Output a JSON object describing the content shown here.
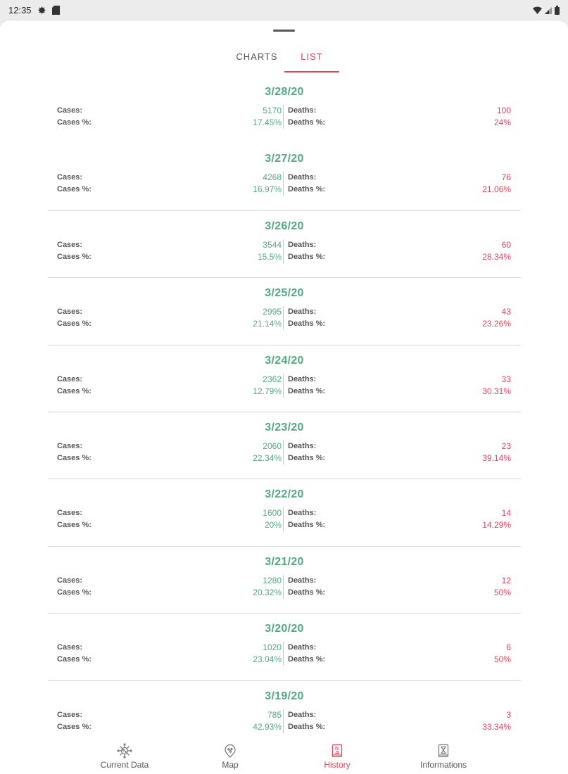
{
  "status_bar": {
    "time": "12:35",
    "icons": [
      "gear-icon",
      "sd-card-icon",
      "wifi-icon",
      "signal-icon",
      "battery-icon"
    ]
  },
  "tabs": [
    {
      "label": "CHARTS",
      "selected": false
    },
    {
      "label": "LIST",
      "selected": true
    }
  ],
  "labels": {
    "cases": "Cases:",
    "cases_pct": "Cases %:",
    "deaths": "Deaths:",
    "deaths_pct": "Deaths %:"
  },
  "entries": [
    {
      "date": "3/28/20",
      "cases": "5170",
      "cases_pct": "17.45%",
      "deaths": "100",
      "deaths_pct": "24%"
    },
    {
      "date": "3/27/20",
      "cases": "4268",
      "cases_pct": "16.97%",
      "deaths": "76",
      "deaths_pct": "21.06%"
    },
    {
      "date": "3/26/20",
      "cases": "3544",
      "cases_pct": "15.5%",
      "deaths": "60",
      "deaths_pct": "28.34%"
    },
    {
      "date": "3/25/20",
      "cases": "2995",
      "cases_pct": "21.14%",
      "deaths": "43",
      "deaths_pct": "23.26%"
    },
    {
      "date": "3/24/20",
      "cases": "2362",
      "cases_pct": "12.79%",
      "deaths": "33",
      "deaths_pct": "30.31%"
    },
    {
      "date": "3/23/20",
      "cases": "2060",
      "cases_pct": "22.34%",
      "deaths": "23",
      "deaths_pct": "39.14%"
    },
    {
      "date": "3/22/20",
      "cases": "1600",
      "cases_pct": "20%",
      "deaths": "14",
      "deaths_pct": "14.29%"
    },
    {
      "date": "3/21/20",
      "cases": "1280",
      "cases_pct": "20.32%",
      "deaths": "12",
      "deaths_pct": "50%"
    },
    {
      "date": "3/20/20",
      "cases": "1020",
      "cases_pct": "23.04%",
      "deaths": "6",
      "deaths_pct": "50%"
    },
    {
      "date": "3/19/20",
      "cases": "785",
      "cases_pct": "42.93%",
      "deaths": "3",
      "deaths_pct": "33.34%"
    }
  ],
  "bottom_nav": [
    {
      "label": "Current Data",
      "icon": "virus-icon",
      "selected": false
    },
    {
      "label": "Map",
      "icon": "map-pin-icon",
      "selected": false
    },
    {
      "label": "History",
      "icon": "history-book-icon",
      "selected": true
    },
    {
      "label": "Informations",
      "icon": "info-book-icon",
      "selected": false
    }
  ],
  "colors": {
    "accent_red": "#e0455b",
    "accent_green": "#52a983"
  }
}
